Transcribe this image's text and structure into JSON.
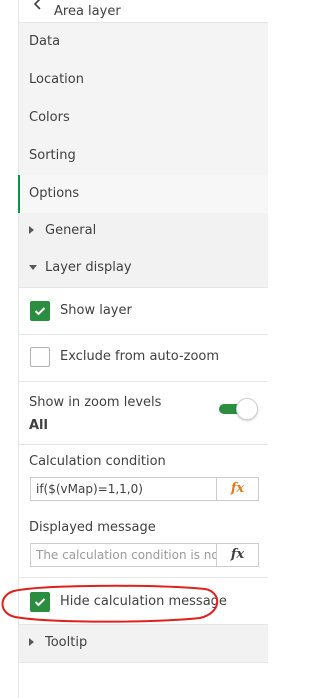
{
  "header": {
    "title": "Area layer",
    "back_icon": "chevron-left-icon"
  },
  "tabs": [
    {
      "label": "Data",
      "active": false
    },
    {
      "label": "Location",
      "active": false
    },
    {
      "label": "Colors",
      "active": false
    },
    {
      "label": "Sorting",
      "active": false
    },
    {
      "label": "Options",
      "active": true
    }
  ],
  "sections": {
    "general": {
      "label": "General",
      "expanded": false
    },
    "layer_display": {
      "label": "Layer display",
      "expanded": true
    },
    "tooltip": {
      "label": "Tooltip",
      "expanded": false
    }
  },
  "layer_display": {
    "show_layer": {
      "label": "Show layer",
      "checked": true
    },
    "exclude_auto_zoom": {
      "label": "Exclude from auto-zoom",
      "checked": false
    },
    "zoom_levels": {
      "label": "Show in zoom levels",
      "value": "All",
      "toggle_on": true
    },
    "calculation_condition": {
      "label": "Calculation condition",
      "value": "if($(vMap)=1,1,0)",
      "fx_label": "fx"
    },
    "displayed_message": {
      "label": "Displayed message",
      "placeholder": "The calculation condition is not met",
      "fx_label": "fx"
    },
    "hide_calc_message": {
      "label": "Hide calculation message",
      "checked": true
    }
  },
  "colors": {
    "accent_green": "#2a8d3f",
    "fx_orange": "#e07b1f",
    "annotation_red": "#e0201a"
  }
}
